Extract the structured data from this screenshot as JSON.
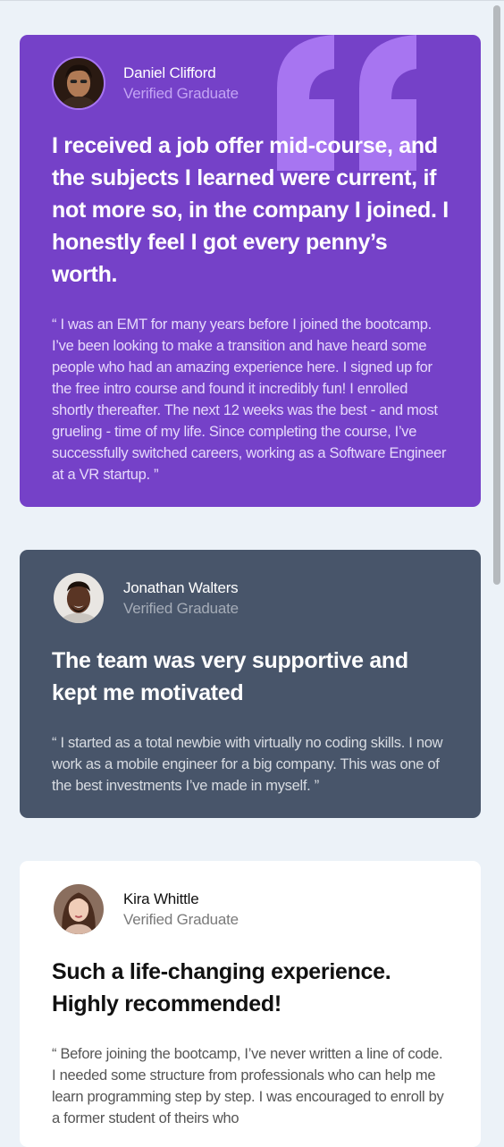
{
  "colors": {
    "page_background": "#ecf2f8",
    "card_purple": "#7541c8",
    "card_slate": "#48556a",
    "card_white": "#ffffff",
    "quote_mark": "#a775f1"
  },
  "testimonials": [
    {
      "name": "Daniel Clifford",
      "role": "Verified Graduate",
      "headline": "I received a job offer mid-course, and the subjects I learned were current, if not more so, in the company I joined. I honestly feel I got every penny’s worth.",
      "body": "“ I was an EMT for many years before I joined the bootcamp. I’ve been looking to make a transition and have heard some people who had an amazing experience here. I signed up for the free intro course and found it incredibly fun! I enrolled shortly thereafter. The next 12 weeks was the best - and most grueling - time of my life. Since completing the course, I’ve successfully switched careers, working as a Software Engineer at a VR startup. ”",
      "theme": "purple",
      "avatar_icon": "avatar-daniel"
    },
    {
      "name": "Jonathan Walters",
      "role": "Verified Graduate",
      "headline": "The team was very supportive and kept me motivated",
      "body": "“ I started as a total newbie with virtually no coding skills. I now work as a mobile engineer for a big company. This was one of the best investments I’ve made in myself. ”",
      "theme": "slate",
      "avatar_icon": "avatar-jonathan"
    },
    {
      "name": "Kira Whittle",
      "role": "Verified Graduate",
      "headline": "Such a life-changing experience. Highly recommended!",
      "body": "“ Before joining the bootcamp, I’ve never written a line of code. I needed some structure from professionals who can help me learn programming step by step. I was encouraged to enroll by a former student of theirs who",
      "theme": "white",
      "avatar_icon": "avatar-kira"
    }
  ]
}
